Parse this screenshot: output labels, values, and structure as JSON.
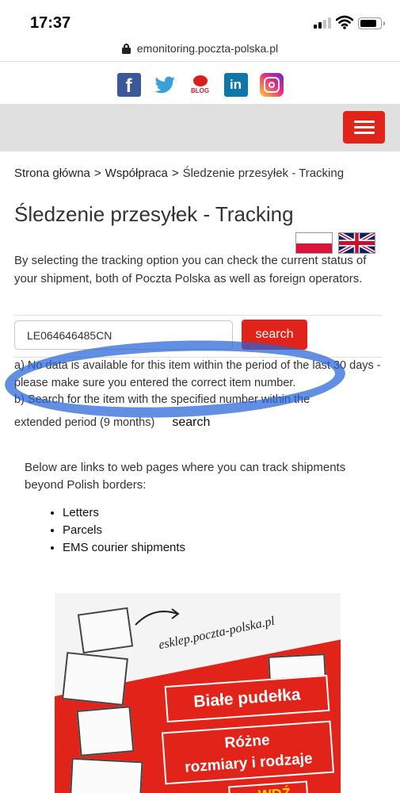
{
  "status_bar": {
    "time": "17:37"
  },
  "browser": {
    "url": "emonitoring.poczta-polska.pl"
  },
  "social": {
    "facebook_glyph": "f",
    "linkedin_glyph": "in",
    "blog_label": "BLOG"
  },
  "colors": {
    "accent": "#e2231a",
    "nav_band": "#e0e0e0",
    "highlight": "#2664d6"
  },
  "breadcrumb": {
    "home": "Strona główna",
    "cooperation": "Współpraca",
    "current": "Śledzenie przesyłek - Tracking"
  },
  "page": {
    "title": "Śledzenie przesyłek - Tracking",
    "intro": "By selecting the tracking option you can check the current status of your shipment, both of Poczta Polska as well as foreign operators."
  },
  "tracking": {
    "number": "LE064646485CN",
    "search_label": "search"
  },
  "messages": {
    "a": "a) No data is available for this item within the period of the last 30 days - please make sure you entered the correct item number.",
    "b": "b) Search for the item with the specified number within the",
    "extended": "extended period (9 months)",
    "extended_search": "search"
  },
  "links": {
    "intro": "Below are links to web pages where you can track shipments beyond Polish borders:",
    "items": [
      "Letters",
      "Parcels",
      "EMS courier shipments"
    ]
  },
  "banner": {
    "url": "esklep.poczta-polska.pl",
    "line1": "Białe pudełka",
    "line2": "Różne",
    "line3": "rozmiary i rodzaje",
    "line4": "...WDŹ"
  },
  "icons": {
    "lock": "lock-icon",
    "facebook": "facebook-icon",
    "twitter": "twitter-icon",
    "blog": "blog-icon",
    "linkedin": "linkedin-icon",
    "instagram": "instagram-icon",
    "menu": "hamburger-icon",
    "flag_pl": "polish-flag-icon",
    "flag_uk": "uk-flag-icon"
  }
}
